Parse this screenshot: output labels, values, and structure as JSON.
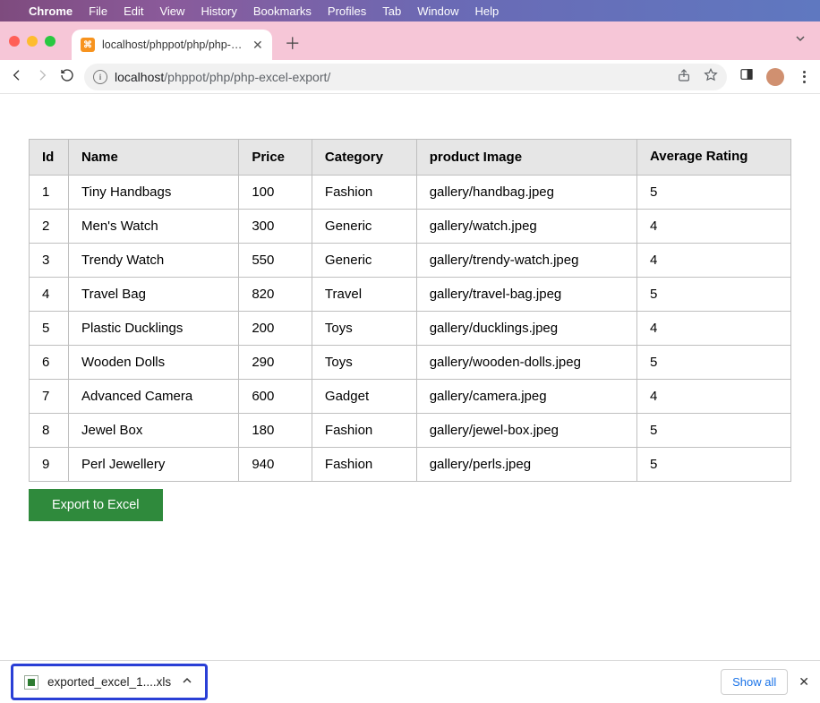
{
  "menubar": {
    "app": "Chrome",
    "items": [
      "File",
      "Edit",
      "View",
      "History",
      "Bookmarks",
      "Profiles",
      "Tab",
      "Window",
      "Help"
    ]
  },
  "tab": {
    "title": "localhost/phppot/php/php-exc…"
  },
  "omnibox": {
    "host": "localhost",
    "path": "/phppot/php/php-excel-export/"
  },
  "table": {
    "headers": [
      "Id",
      "Name",
      "Price",
      "Category",
      "product Image",
      "Average Rating"
    ],
    "rows": [
      {
        "id": "1",
        "name": "Tiny Handbags",
        "price": "100",
        "category": "Fashion",
        "image": "gallery/handbag.jpeg",
        "rating": "5"
      },
      {
        "id": "2",
        "name": "Men's Watch",
        "price": "300",
        "category": "Generic",
        "image": "gallery/watch.jpeg",
        "rating": "4"
      },
      {
        "id": "3",
        "name": "Trendy Watch",
        "price": "550",
        "category": "Generic",
        "image": "gallery/trendy-watch.jpeg",
        "rating": "4"
      },
      {
        "id": "4",
        "name": "Travel Bag",
        "price": "820",
        "category": "Travel",
        "image": "gallery/travel-bag.jpeg",
        "rating": "5"
      },
      {
        "id": "5",
        "name": "Plastic Ducklings",
        "price": "200",
        "category": "Toys",
        "image": "gallery/ducklings.jpeg",
        "rating": "4"
      },
      {
        "id": "6",
        "name": "Wooden Dolls",
        "price": "290",
        "category": "Toys",
        "image": "gallery/wooden-dolls.jpeg",
        "rating": "5"
      },
      {
        "id": "7",
        "name": "Advanced Camera",
        "price": "600",
        "category": "Gadget",
        "image": "gallery/camera.jpeg",
        "rating": "4"
      },
      {
        "id": "8",
        "name": "Jewel Box",
        "price": "180",
        "category": "Fashion",
        "image": "gallery/jewel-box.jpeg",
        "rating": "5"
      },
      {
        "id": "9",
        "name": "Perl Jewellery",
        "price": "940",
        "category": "Fashion",
        "image": "gallery/perls.jpeg",
        "rating": "5"
      }
    ]
  },
  "buttons": {
    "export": "Export to Excel",
    "show_all": "Show all"
  },
  "download": {
    "filename": "exported_excel_1....xls"
  }
}
